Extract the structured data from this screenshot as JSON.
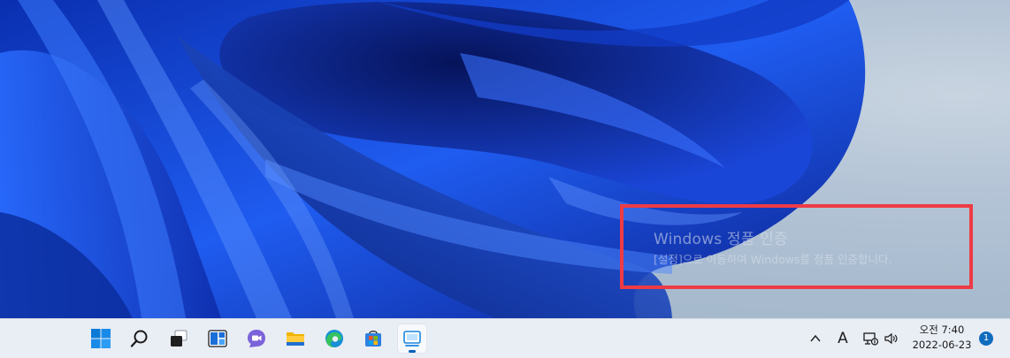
{
  "activation": {
    "title": "Windows 정품 인증",
    "subtitle": "[설정]으로 이동하여 Windows를 정품 인증합니다."
  },
  "taskbar": {
    "apps": [
      {
        "name": "start",
        "icon": "windows-start-icon"
      },
      {
        "name": "search",
        "icon": "search-icon"
      },
      {
        "name": "task-view",
        "icon": "task-view-icon"
      },
      {
        "name": "widgets",
        "icon": "widgets-icon"
      },
      {
        "name": "chat",
        "icon": "teams-chat-icon"
      },
      {
        "name": "file-explorer",
        "icon": "folder-icon"
      },
      {
        "name": "edge",
        "icon": "edge-icon"
      },
      {
        "name": "store",
        "icon": "store-icon"
      },
      {
        "name": "active-app",
        "icon": "app-window-icon",
        "active": true
      }
    ],
    "tray": {
      "input_indicator": "A",
      "clock_time": "오전 7:40",
      "clock_date": "2022-06-23",
      "notification_count": "1"
    }
  },
  "colors": {
    "accent": "#005fb8",
    "highlight_border": "#ee3b44",
    "wallpaper_blue": "#1a4fe0"
  }
}
